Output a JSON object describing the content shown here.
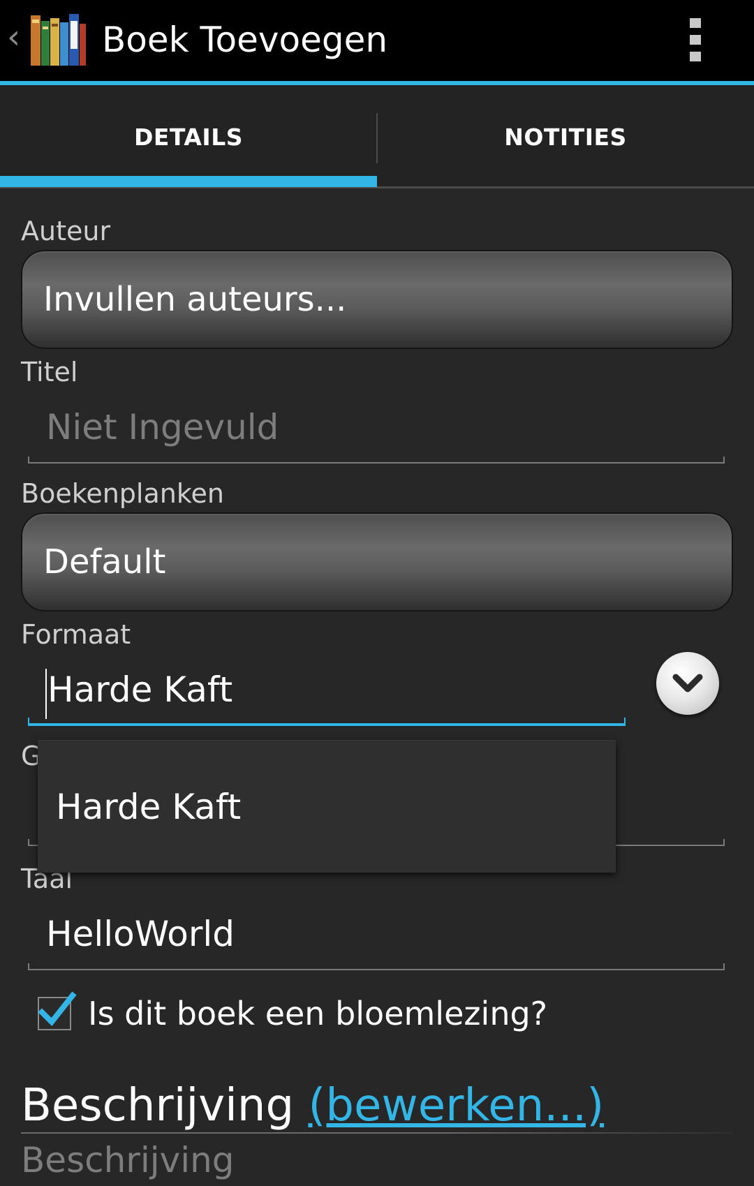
{
  "actionbar": {
    "title": "Boek Toevoegen",
    "back_icon": "chevron-left-icon",
    "app_icon": "books-icon",
    "overflow_icon": "overflow-menu-icon"
  },
  "tabs": [
    {
      "label": "DETAILS",
      "selected": true
    },
    {
      "label": "NOTITIES",
      "selected": false
    }
  ],
  "form": {
    "author": {
      "label": "Auteur",
      "button": "Invullen auteurs..."
    },
    "title": {
      "label": "Titel",
      "value": "",
      "placeholder": "Niet Ingevuld"
    },
    "bookshelves": {
      "label": "Boekenplanken",
      "button": "Default"
    },
    "format": {
      "label": "Formaat",
      "value": "Harde Kaft",
      "dropdown_icon": "chevron-down-icon"
    },
    "hidden_label_fragment": "G",
    "format_suggestion": {
      "item": "Harde Kaft"
    },
    "language": {
      "label": "Taal",
      "value": "HelloWorld"
    },
    "anthology": {
      "label": "Is dit boek een bloemlezing?",
      "checked": true
    },
    "description": {
      "heading": "Beschrijving",
      "edit_link": "(bewerken...)",
      "placeholder": "Beschrijving"
    }
  },
  "colors": {
    "accent": "#33b5e5",
    "background": "#272727",
    "actionbar": "#000000"
  }
}
